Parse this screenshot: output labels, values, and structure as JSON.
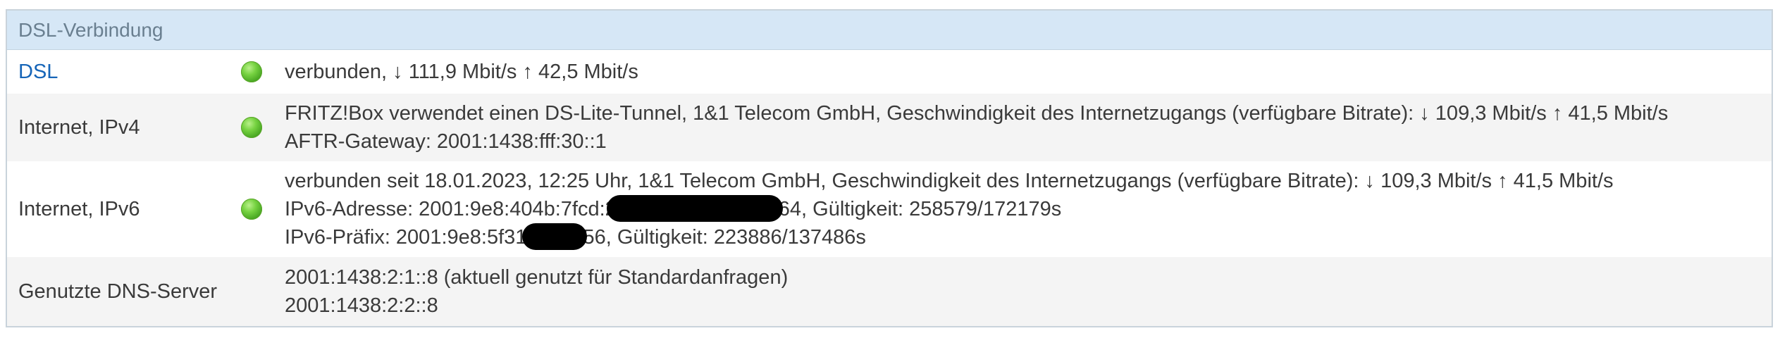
{
  "section": {
    "title": "DSL-Verbindung"
  },
  "rows": [
    {
      "label": "DSL",
      "status": "green",
      "lines": [
        "verbunden, ↓ 111,9 Mbit/s ↑ 42,5 Mbit/s"
      ]
    },
    {
      "label": "Internet, IPv4",
      "status": "green",
      "lines": [
        "FRITZ!Box verwendet einen DS-Lite-Tunnel, 1&1 Telecom GmbH, Geschwindigkeit des Internetzugangs (verfügbare Bitrate): ↓ 109,3 Mbit/s ↑ 41,5 Mbit/s",
        "AFTR-Gateway: 2001:1438:fff:30::1"
      ]
    },
    {
      "label": "Internet, IPv6",
      "status": "green",
      "lines": [
        "verbunden seit 18.01.2023, 12:25 Uhr, 1&1 Telecom GmbH, Geschwindigkeit des Internetzugangs (verfügbare Bitrate): ↓ 109,3 Mbit/s ↑ 41,5 Mbit/s"
      ],
      "ipv6_address_prefix": "IPv6-Adresse: 2001:9e8:404b:7fcd:2",
      "ipv6_address_suffix": "64, Gültigkeit: 258579/172179s",
      "ipv6_prefix_prefix": "IPv6-Präfix: 2001:9e8:5f31:",
      "ipv6_prefix_suffix": "56, Gültigkeit: 223886/137486s"
    },
    {
      "label": "Genutzte DNS-Server",
      "lines": [
        "2001:1438:2:1::8 (aktuell genutzt für Standardanfragen)",
        "2001:1438:2:2::8"
      ]
    }
  ],
  "colors": {
    "header_bg": "#d6e7f6",
    "link": "#1665b8",
    "led_green": "#5cc02a"
  }
}
